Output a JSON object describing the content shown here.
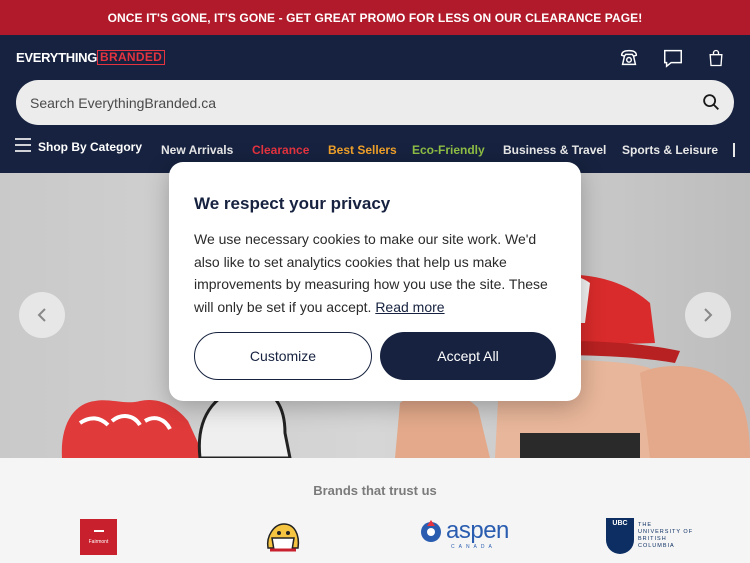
{
  "promo": {
    "text": "ONCE IT'S GONE, IT'S GONE - GET GREAT PROMO FOR LESS ON OUR CLEARANCE PAGE!"
  },
  "header": {
    "logo_part1": "EVERYTHING",
    "logo_part2": "BRANDED",
    "icons": [
      "phone-icon",
      "chat-icon",
      "bag-icon"
    ]
  },
  "search": {
    "placeholder": "Search EverythingBranded.ca",
    "icon": "search-icon"
  },
  "nav": {
    "category_label": "Shop By Category",
    "items": [
      {
        "label": "New Arrivals",
        "color": "#e8e8e8"
      },
      {
        "label": "Clearance",
        "color": "#e5333f"
      },
      {
        "label": "Best Sellers",
        "color": "#f0a12a"
      },
      {
        "label": "Eco-Friendly",
        "color": "#8fbf45"
      },
      {
        "label": "Business & Travel",
        "color": "#e8e8e8"
      },
      {
        "label": "Sports & Leisure",
        "color": "#e8e8e8"
      }
    ]
  },
  "brands": {
    "title": "Brands that trust us",
    "logos": [
      {
        "name": "Fairmont",
        "text": "Fairmont"
      },
      {
        "name": "mascot-logo"
      },
      {
        "name": "aspen",
        "text": "aspen",
        "subtext": "CANADA"
      },
      {
        "name": "ubc",
        "text": "UBC",
        "subtext_lines": [
          "THE",
          "UNIVERSITY OF",
          "BRITISH",
          "COLUMBIA"
        ]
      }
    ]
  },
  "cookie": {
    "title": "We respect your privacy",
    "body": "We use necessary cookies to make our site work. We'd also like to set analytics cookies that help us make improvements by measuring how you use the site. These will only be set if you accept. ",
    "link": "Read more",
    "customize_label": "Customize",
    "accept_label": "Accept All"
  },
  "colors": {
    "navy": "#16223f",
    "promo_red": "#b01a2a",
    "logo_red": "#e5333f"
  }
}
